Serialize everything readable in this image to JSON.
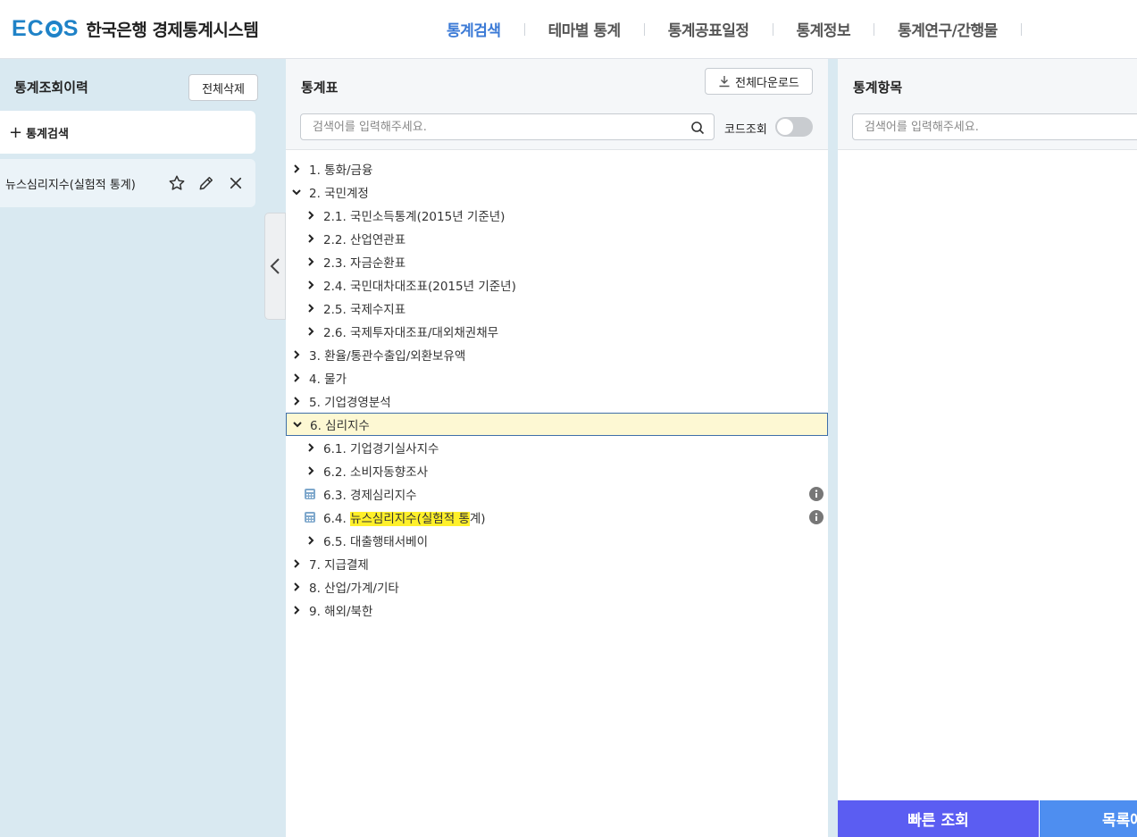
{
  "header": {
    "logo": "ECOS",
    "site_title": "한국은행 경제통계시스템",
    "nav": [
      {
        "label": "통계검색",
        "active": true
      },
      {
        "label": "테마별 통계",
        "active": false
      },
      {
        "label": "통계공표일정",
        "active": false
      },
      {
        "label": "통계정보",
        "active": false
      },
      {
        "label": "통계연구/간행물",
        "active": false
      }
    ]
  },
  "left_panel": {
    "title": "통계조회이력",
    "clear_all_label": "전체삭제",
    "new_search_label": "통계검색",
    "history": [
      {
        "label": "뉴스심리지수(실험적 통계)"
      }
    ]
  },
  "middle_panel": {
    "title": "통계표",
    "download_all_label": "전체다운로드",
    "search_placeholder": "검색어를 입력해주세요.",
    "code_lookup_label": "코드조회",
    "code_lookup_on": false,
    "tree": [
      {
        "label": "1. 통화/금융",
        "level": 0,
        "expanded": false
      },
      {
        "label": "2. 국민계정",
        "level": 0,
        "expanded": true
      },
      {
        "label": "2.1. 국민소득통계(2015년 기준년)",
        "level": 1,
        "expanded": false
      },
      {
        "label": "2.2. 산업연관표",
        "level": 1,
        "expanded": false
      },
      {
        "label": "2.3. 자금순환표",
        "level": 1,
        "expanded": false
      },
      {
        "label": "2.4. 국민대차대조표(2015년 기준년)",
        "level": 1,
        "expanded": false
      },
      {
        "label": "2.5. 국제수지표",
        "level": 1,
        "expanded": false
      },
      {
        "label": "2.6. 국제투자대조표/대외채권채무",
        "level": 1,
        "expanded": false
      },
      {
        "label": "3. 환율/통관수출입/외환보유액",
        "level": 0,
        "expanded": false
      },
      {
        "label": "4. 물가",
        "level": 0,
        "expanded": false
      },
      {
        "label": "5. 기업경영분석",
        "level": 0,
        "expanded": false
      },
      {
        "label": "6. 심리지수",
        "level": 0,
        "expanded": true,
        "selected": true
      },
      {
        "label": "6.1. 기업경기실사지수",
        "level": 1,
        "expanded": false
      },
      {
        "label": "6.2. 소비자동향조사",
        "level": 1,
        "expanded": false
      },
      {
        "label": "6.3. 경제심리지수",
        "level": 1,
        "leaf": true
      },
      {
        "prefix": "6.4. ",
        "highlight": "뉴스심리지수(실험적 통",
        "suffix": "계)",
        "level": 1,
        "leaf": true
      },
      {
        "label": "6.5. 대출행태서베이",
        "level": 1,
        "expanded": false
      },
      {
        "label": "7. 지급결제",
        "level": 0,
        "expanded": false
      },
      {
        "label": "8. 산업/가계/기타",
        "level": 0,
        "expanded": false
      },
      {
        "label": "9. 해외/북한",
        "level": 0,
        "expanded": false
      }
    ]
  },
  "right_panel": {
    "title": "통계항목",
    "search_placeholder": "검색어를 입력해주세요.",
    "quick_query_label": "빠른 조회",
    "list_label": "목록에"
  },
  "colors": {
    "accent_nav": "#3b7ad6",
    "side_bg": "#d9e9f1",
    "selected_bg": "#fdf8d3",
    "highlight": "#fff02a",
    "quick_btn": "#5b5df2",
    "list_btn": "#4e8ef0"
  }
}
